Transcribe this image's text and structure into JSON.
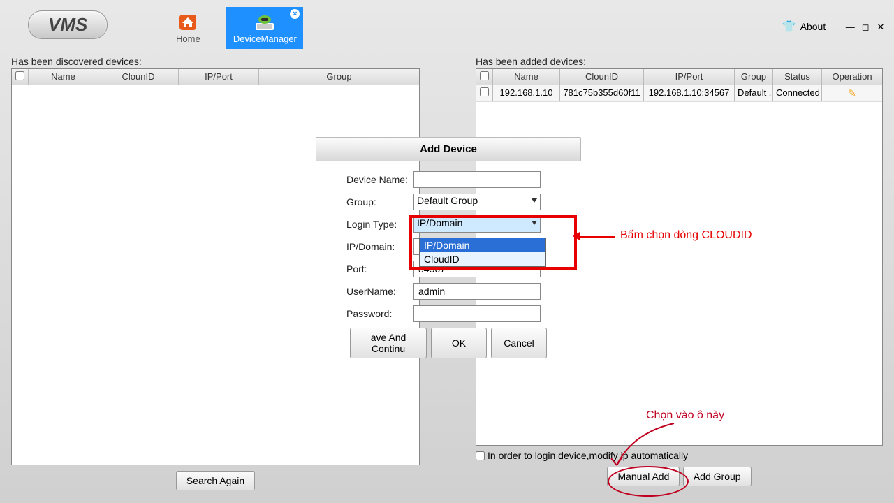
{
  "app": {
    "logo": "VMS"
  },
  "tabs": {
    "home": {
      "label": "Home"
    },
    "device_manager": {
      "label": "DeviceManager"
    }
  },
  "titlebar": {
    "about": "About"
  },
  "left": {
    "title": "Has been discovered devices:",
    "headers": {
      "name": "Name",
      "clounid": "ClounID",
      "ipport": "IP/Port",
      "group": "Group"
    },
    "search_again": "Search Again"
  },
  "right": {
    "title": "Has been added devices:",
    "headers": {
      "name": "Name",
      "clounid": "ClounID",
      "ipport": "IP/Port",
      "group": "Group",
      "status": "Status",
      "operation": "Operation"
    },
    "row": {
      "name": "192.168.1.10",
      "clounid": "781c75b355d60f11",
      "ipport": "192.168.1.10:34567",
      "group": "Default ...",
      "status": "Connected"
    },
    "auto_ip": "In order to login device,modify ip automatically",
    "manual_add": "Manual Add",
    "add_group": "Add Group"
  },
  "dialog": {
    "title": "Add Device",
    "device_name_lbl": "Device Name:",
    "group_lbl": "Group:",
    "group_val": "Default Group",
    "login_type_lbl": "Login Type:",
    "login_type_val": "IP/Domain",
    "ip_domain_lbl": "IP/Domain:",
    "port_lbl": "Port:",
    "port_val": "34567",
    "username_lbl": "UserName:",
    "username_val": "admin",
    "password_lbl": "Password:",
    "save_continue": "ave And Continu",
    "ok": "OK",
    "cancel": "Cancel",
    "options": {
      "ip_domain": "IP/Domain",
      "cloudid": "CloudID"
    }
  },
  "annot": {
    "cloudid_text": "Bấm chọn dòng CLOUDID",
    "manual_add_text": "Chọn vào ô này"
  }
}
